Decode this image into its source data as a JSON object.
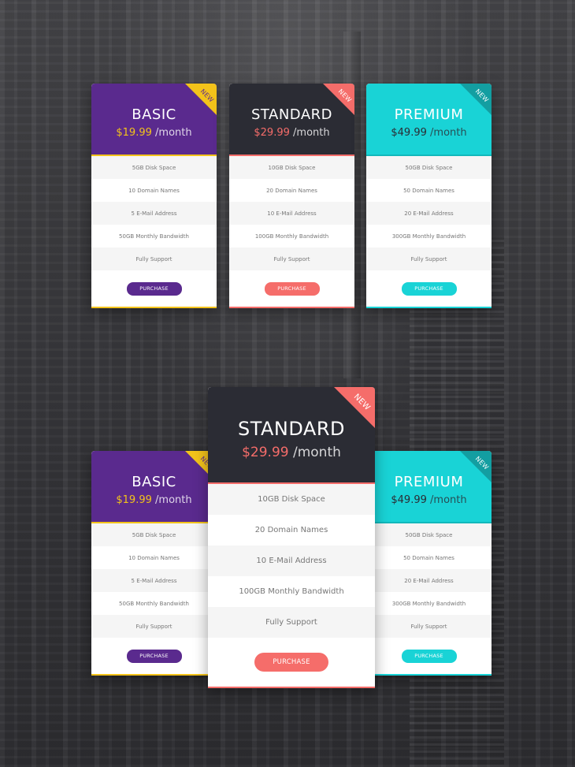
{
  "ribbon_label": "NEW",
  "top_cards": [
    {
      "theme": "basic",
      "name": "BASIC",
      "price": "$19.99",
      "period": "/month",
      "features": [
        "5GB Disk Space",
        "10 Domain Names",
        "5 E-Mail Address",
        "50GB Monthly Bandwidth",
        "Fully Support"
      ],
      "button": "PURCHASE"
    },
    {
      "theme": "standard",
      "name": "STANDARD",
      "price": "$29.99",
      "period": "/month",
      "features": [
        "10GB Disk Space",
        "20 Domain Names",
        "10 E-Mail Address",
        "100GB Monthly Bandwidth",
        "Fully Support"
      ],
      "button": "PURCHASE"
    },
    {
      "theme": "premium",
      "name": "PREMIUM",
      "price": "$49.99",
      "period": "/month",
      "features": [
        "50GB Disk Space",
        "50 Domain Names",
        "20 E-Mail Address",
        "300GB Monthly Bandwidth",
        "Fully Support"
      ],
      "button": "PURCHASE"
    }
  ],
  "bottom_cards": [
    {
      "theme": "basic",
      "name": "BASIC",
      "price": "$19.99",
      "period": "/month",
      "features": [
        "5GB Disk Space",
        "10 Domain Names",
        "5 E-Mail Address",
        "50GB Monthly Bandwidth",
        "Fully Support"
      ],
      "button": "PURCHASE"
    },
    {
      "theme": "premium",
      "name": "PREMIUM",
      "price": "$49.99",
      "period": "/month",
      "features": [
        "50GB Disk Space",
        "50 Domain Names",
        "20 E-Mail Address",
        "300GB Monthly Bandwidth",
        "Fully Support"
      ],
      "button": "PURCHASE"
    },
    {
      "theme": "standard",
      "name": "STANDARD",
      "price": "$29.99",
      "period": "/month",
      "features": [
        "10GB Disk Space",
        "20 Domain Names",
        "10 E-Mail Address",
        "100GB Monthly Bandwidth",
        "Fully Support"
      ],
      "button": "PURCHASE"
    }
  ],
  "colors": {
    "basic": "#5a2a8e",
    "basic_accent": "#f3c31a",
    "standard": "#2b2c34",
    "standard_accent": "#f56d6a",
    "premium": "#19d3d6"
  }
}
